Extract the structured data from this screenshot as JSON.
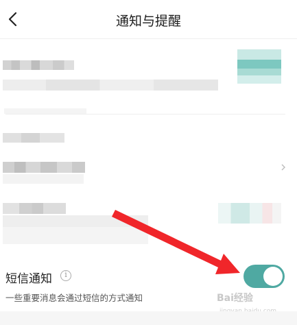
{
  "header": {
    "title": "通知与提醒",
    "back_icon": "chevron-left-icon"
  },
  "sms": {
    "title": "短信通知",
    "info_icon": "info-icon",
    "description": "一些重要消息会通过短信的方式通知",
    "enabled": true
  },
  "watermark": {
    "text": "Bai经验",
    "sub": "jingyan.baidu.com"
  },
  "colors": {
    "toggle_on": "#4fa9a2",
    "arrow": "#f0262a"
  }
}
